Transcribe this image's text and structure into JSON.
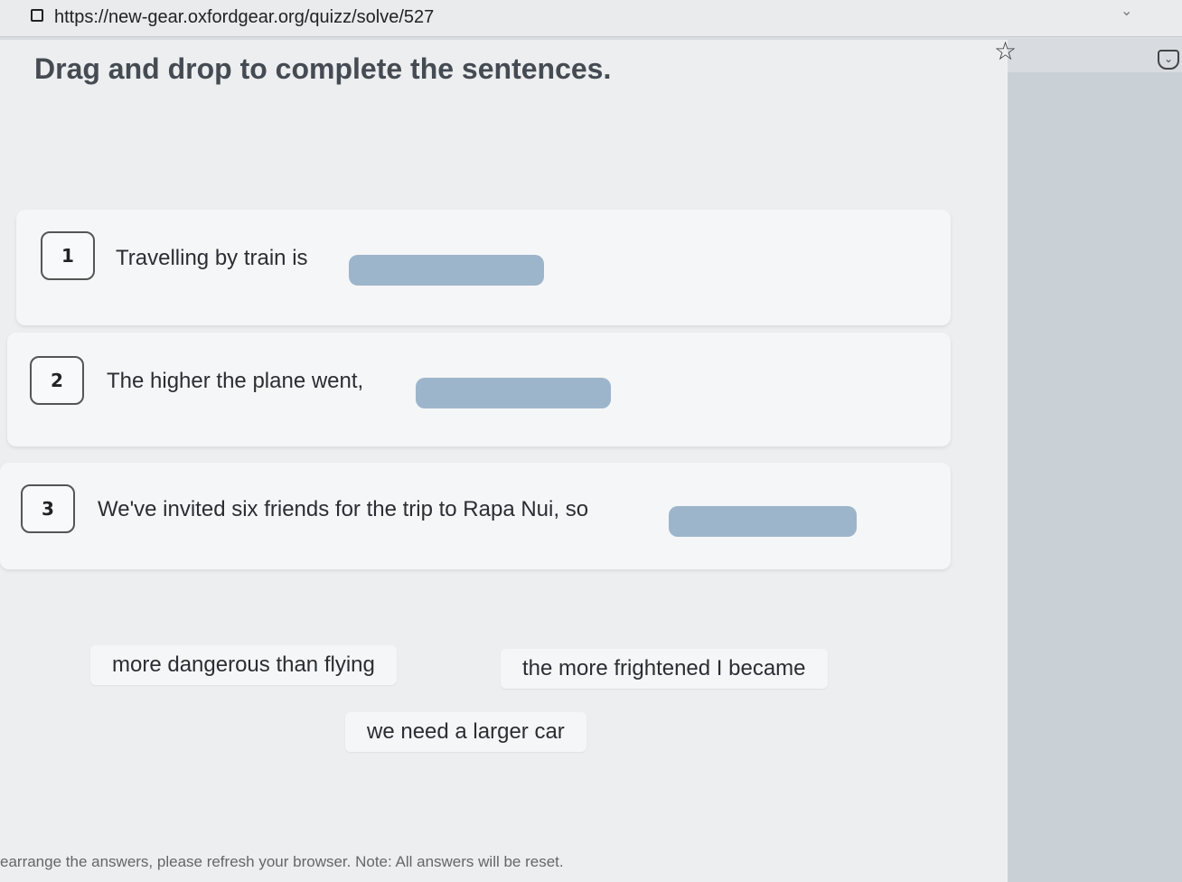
{
  "browser": {
    "url": "https://new-gear.oxfordgear.org/quizz/solve/527",
    "tab_menu_icon": "chevron-down-icon",
    "bookmark_icon": "star-icon",
    "pocket_icon": "pocket-icon"
  },
  "quiz": {
    "title": "Drag and drop to complete the sentences.",
    "questions": [
      {
        "number": "1",
        "text": "Travelling by train is"
      },
      {
        "number": "2",
        "text": "The higher the plane went,"
      },
      {
        "number": "3",
        "text": "We've invited six friends for the trip to Rapa Nui, so"
      }
    ],
    "options": [
      "more dangerous than flying",
      "the more frightened I became",
      "we need a larger car"
    ],
    "note": "earrange the answers, please refresh your browser. Note: All answers will be reset."
  },
  "colors": {
    "drop_zone": "#9db5cb",
    "title_text": "#454b52"
  }
}
